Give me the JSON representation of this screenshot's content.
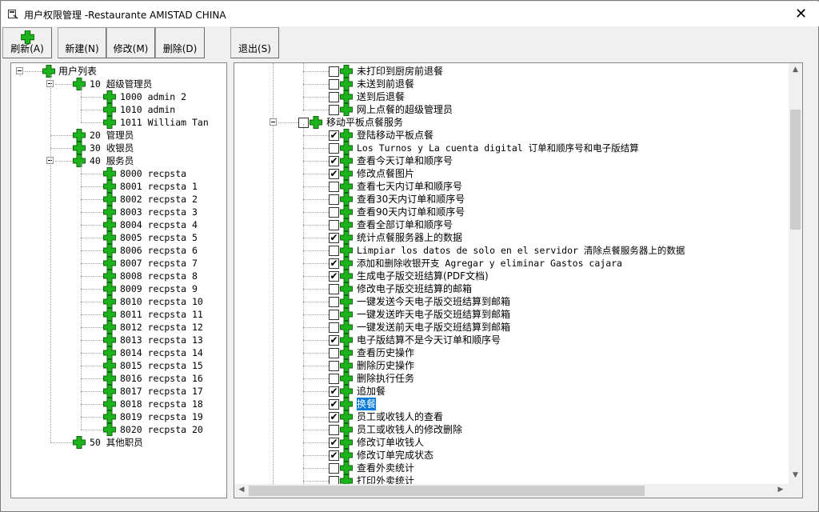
{
  "window": {
    "title": "用户权限管理 -Restaurante AMISTAD CHINA"
  },
  "toolbar": {
    "refresh": "刷新(A)",
    "new": "新建(N)",
    "edit": "修改(M)",
    "delete": "删除(D)",
    "exit": "退出(S)"
  },
  "left_tree": {
    "root": "用户列表",
    "groups": [
      {
        "label": "10  超级管理员",
        "children": [
          "1000 admin 2",
          "1010 admin",
          "1011 William Tan"
        ]
      },
      {
        "label": "20  管理员",
        "children": []
      },
      {
        "label": "30  收银员",
        "children": []
      },
      {
        "label": "40  服务员",
        "children": [
          "8000 recpsta",
          "8001 recpsta 1",
          "8002 recpsta 2",
          "8003 recpsta 3",
          "8004 recpsta 4",
          "8005 recpsta 5",
          "8006 recpsta 6",
          "8007 recpsta 7",
          "8008 recpsta 8",
          "8009 recpsta 9",
          "8010 recpsta 10",
          "8011 recpsta 11",
          "8012 recpsta 12",
          "8013 recpsta 13",
          "8014 recpsta 14",
          "8015 recpsta 15",
          "8016 recpsta 16",
          "8017 recpsta 17",
          "8018 recpsta 18",
          "8019 recpsta 19",
          "8020 recpsta 20"
        ]
      },
      {
        "label": "50  其他职员",
        "children": []
      }
    ]
  },
  "right_tree": {
    "top_items": [
      {
        "label": "未打印到厨房前退餐",
        "checked": false
      },
      {
        "label": "未送到前退餐",
        "checked": false
      },
      {
        "label": "送到后退餐",
        "checked": false
      },
      {
        "label": "网上点餐的超级管理员",
        "checked": false
      }
    ],
    "group": {
      "label": "移动平板点餐服务",
      "checked": false
    },
    "items": [
      {
        "label": "登陆移动平板点餐",
        "checked": true,
        "mono": false
      },
      {
        "label": "Los Turnos y La cuenta digital 订单和顺序号和电子版结算",
        "checked": false,
        "mono": true
      },
      {
        "label": "查看今天订单和顺序号",
        "checked": true,
        "mono": false
      },
      {
        "label": "修改点餐图片",
        "checked": true,
        "mono": false
      },
      {
        "label": "查看七天内订单和顺序号",
        "checked": false,
        "mono": false
      },
      {
        "label": "查看30天内订单和顺序号",
        "checked": false,
        "mono": false
      },
      {
        "label": "查看90天内订单和顺序号",
        "checked": false,
        "mono": false
      },
      {
        "label": "查看全部订单和顺序号",
        "checked": false,
        "mono": false
      },
      {
        "label": "统计点餐服务器上的数据",
        "checked": true,
        "mono": false
      },
      {
        "label": "Limpiar los datos de solo en el servidor 清除点餐服务器上的数据",
        "checked": false,
        "mono": true
      },
      {
        "label": "添加和删除收银开支 Agregar y eliminar Gastos cajara",
        "checked": true,
        "mono": true
      },
      {
        "label": "生成电子版交班结算(PDF文档)",
        "checked": true,
        "mono": false
      },
      {
        "label": "修改电子版交班结算的邮箱",
        "checked": false,
        "mono": false
      },
      {
        "label": "一键发送今天电子版交班结算到邮箱",
        "checked": false,
        "mono": false
      },
      {
        "label": "一键发送昨天电子版交班结算到邮箱",
        "checked": false,
        "mono": false
      },
      {
        "label": "一键发送前天电子版交班结算到邮箱",
        "checked": false,
        "mono": false
      },
      {
        "label": "电子版结算不是今天订单和顺序号",
        "checked": true,
        "mono": false
      },
      {
        "label": "查看历史操作",
        "checked": false,
        "mono": false
      },
      {
        "label": "删除历史操作",
        "checked": false,
        "mono": false
      },
      {
        "label": "删除执行任务",
        "checked": false,
        "mono": false
      },
      {
        "label": "追加餐",
        "checked": true,
        "mono": false
      },
      {
        "label": "换餐",
        "checked": true,
        "mono": false,
        "selected": true
      },
      {
        "label": "员工或收钱人的查看",
        "checked": true,
        "mono": false
      },
      {
        "label": "员工或收钱人的修改删除",
        "checked": false,
        "mono": false
      },
      {
        "label": "修改订单收钱人",
        "checked": true,
        "mono": false
      },
      {
        "label": "修改订单完成状态",
        "checked": true,
        "mono": false
      },
      {
        "label": "查看外卖统计",
        "checked": false,
        "mono": false
      },
      {
        "label": "打印外卖统计",
        "checked": false,
        "mono": false
      }
    ],
    "vscroll_position": 0.12,
    "hscroll_position": 0.0
  },
  "colors": {
    "plus_green": "#1db31d",
    "selection": "#0078d7"
  }
}
